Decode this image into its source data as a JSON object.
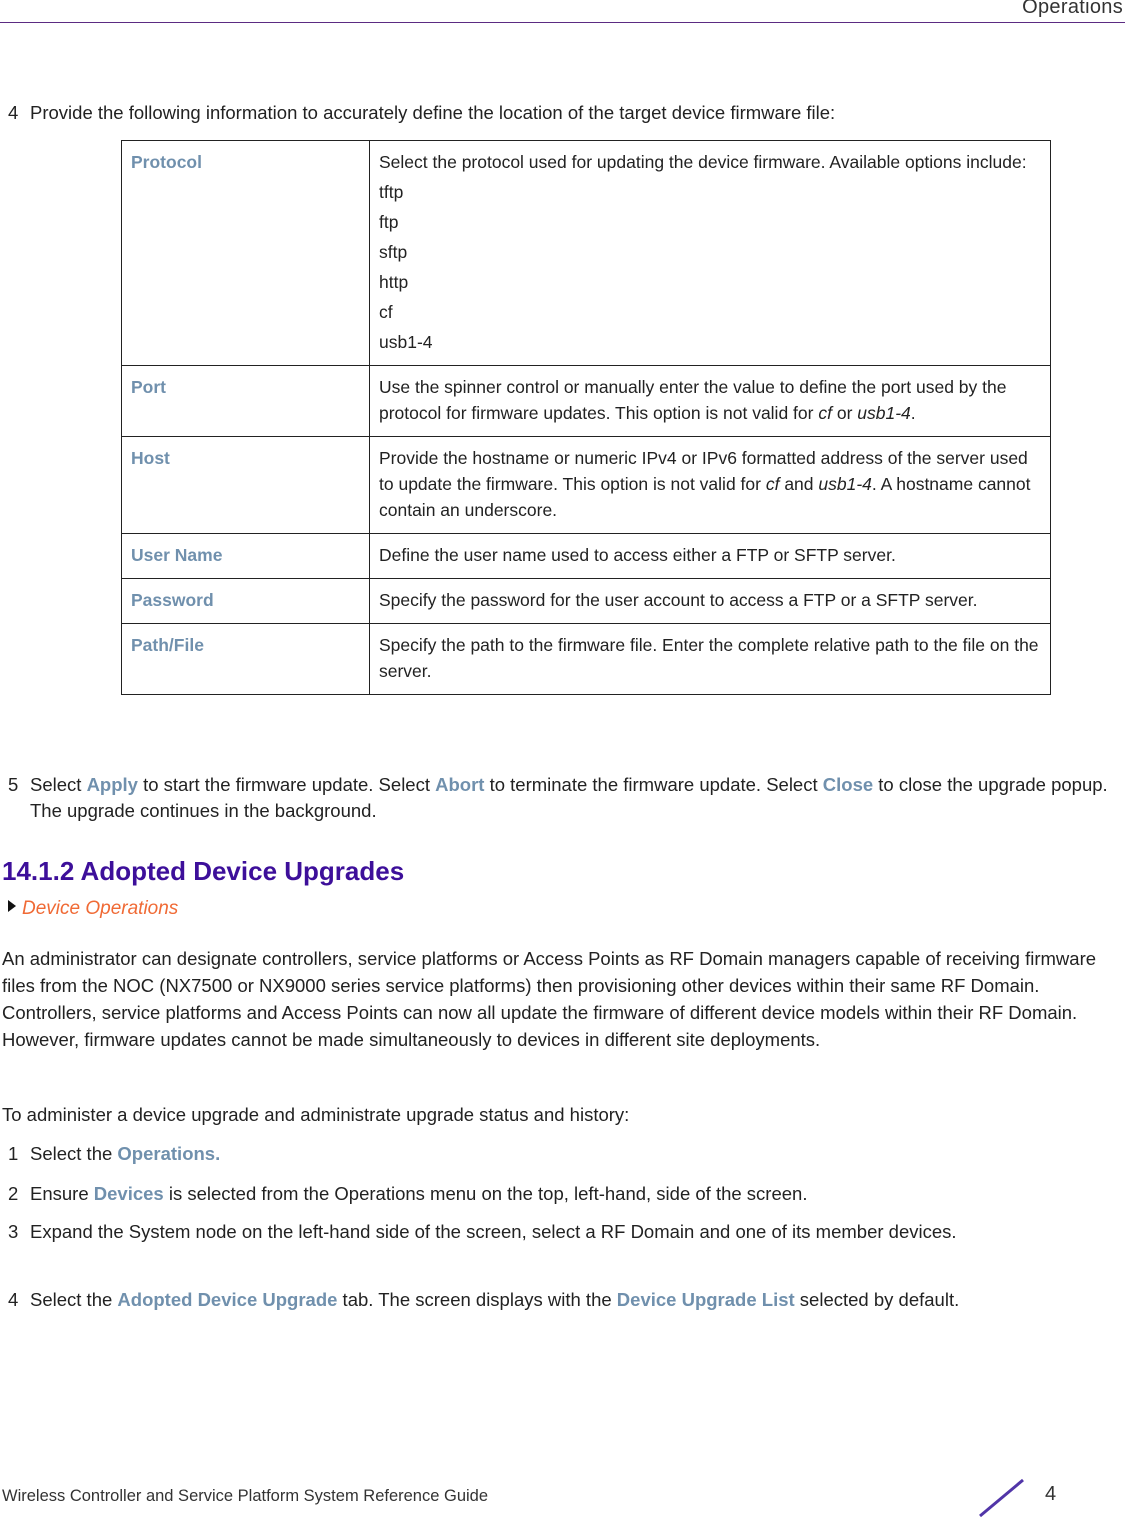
{
  "header": {
    "title": "Operations"
  },
  "step4_intro": {
    "num": "4",
    "text": "Provide the following information to accurately define the location of the target device firmware file:"
  },
  "params": {
    "protocol": {
      "name": "Protocol",
      "desc": "Select the protocol used for updating the device firmware. Available options include:",
      "options": [
        "tftp",
        "ftp",
        "sftp",
        "http",
        "cf",
        "usb1-4"
      ]
    },
    "port": {
      "name": "Port",
      "desc_a": "Use the spinner control or manually enter the value to define the port used by the protocol for firmware updates. This option is not valid for ",
      "em1": "cf",
      "desc_b": " or ",
      "em2": "usb1-4",
      "desc_c": "."
    },
    "host": {
      "name": "Host",
      "desc_a": "Provide the hostname or numeric IPv4 or IPv6 formatted address of the server used to update the firmware. This option is not valid for ",
      "em1": "cf",
      "desc_b": " and ",
      "em2": "usb1-4",
      "desc_c": ". A hostname cannot contain an underscore."
    },
    "username": {
      "name": "User Name",
      "desc": "Define the user name used to access either a FTP or SFTP server."
    },
    "password": {
      "name": "Password",
      "desc": "Specify the password for the user account to access a FTP or a SFTP server."
    },
    "pathfile": {
      "name": "Path/File",
      "desc": "Specify the path to the firmware file. Enter the complete relative path to the file on the server."
    }
  },
  "step5": {
    "num": "5",
    "t1": "Select ",
    "apply": "Apply",
    "t2": " to start the firmware update. Select ",
    "abort": "Abort",
    "t3": " to terminate the firmware update. Select ",
    "close": "Close",
    "t4": " to close the upgrade popup. The upgrade continues in the background."
  },
  "section": {
    "heading": "14.1.2 Adopted Device Upgrades",
    "xref": "Device Operations",
    "para1": "An administrator can designate controllers, service platforms or Access Points as RF Domain managers capable of receiving firmware files from the NOC (NX7500 or NX9000 series service platforms) then provisioning other devices within their same RF Domain. Controllers, service platforms and Access Points can now all update the firmware of different device models within their RF Domain. However, firmware updates cannot be made simultaneously to devices in different site deployments.",
    "para2": "To administer a device upgrade and administrate upgrade status and history:",
    "steps": [
      {
        "num": "1",
        "t1": "Select the ",
        "b1": "Operations.",
        "t2": ""
      },
      {
        "num": "2",
        "t1": "Ensure ",
        "b1": "Devices",
        "t2": " is selected from the Operations menu on the top, left-hand, side of the screen."
      },
      {
        "num": "3",
        "t1": "Expand the System node on the left-hand side of the screen, select a RF Domain and one of its member devices."
      },
      {
        "num": "4",
        "t1": "Select the ",
        "b1": "Adopted Device Upgrade",
        "t2": " tab. The screen displays with the ",
        "b2": "Device Upgrade List",
        "t3": " selected by default."
      }
    ]
  },
  "footer": {
    "guide_title": "Wireless Controller and Service Platform System Reference Guide",
    "page": "4"
  }
}
